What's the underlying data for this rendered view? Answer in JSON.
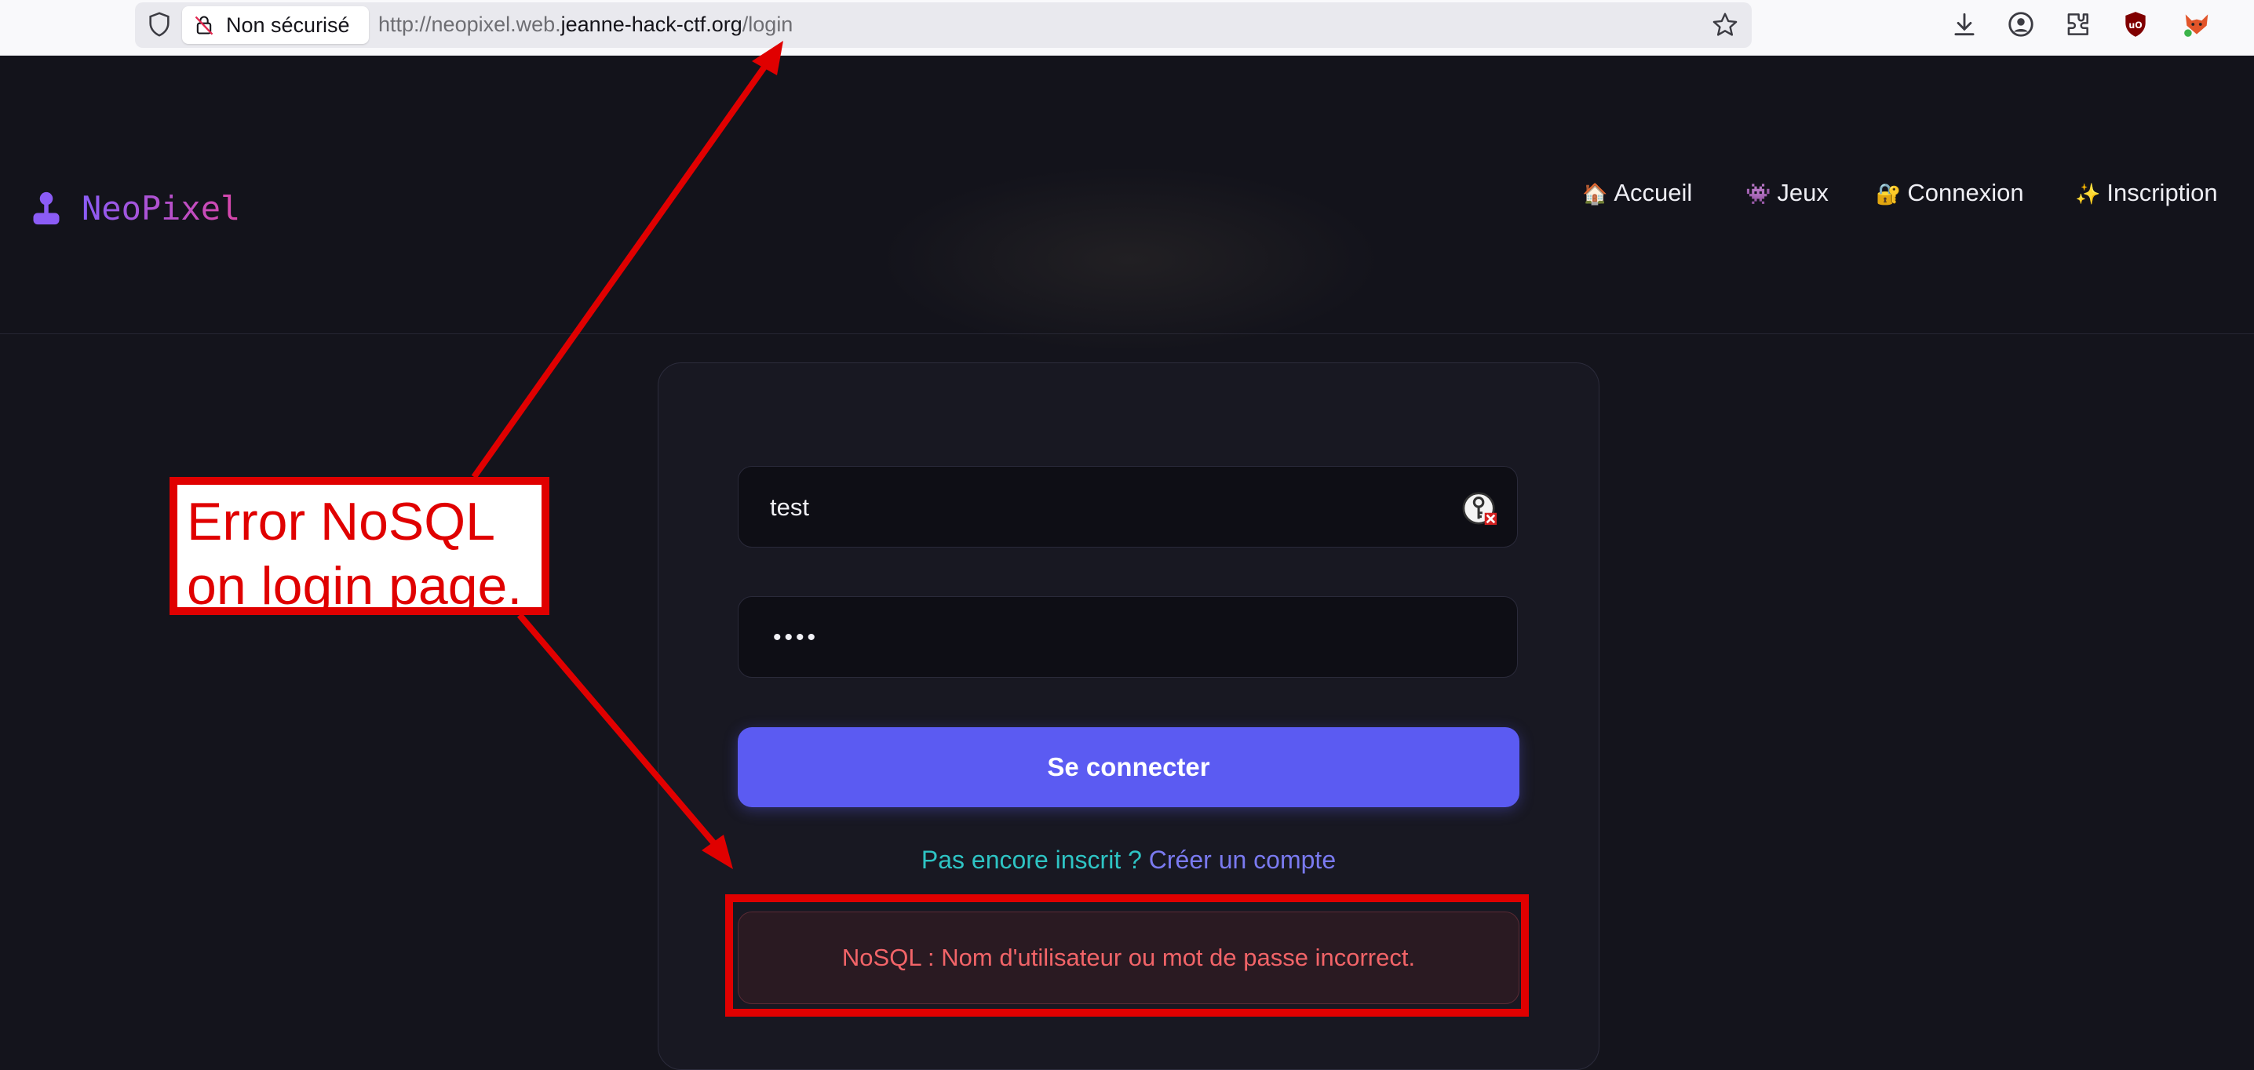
{
  "browser": {
    "security_label": "Non sécurisé",
    "url_prefix": "http://neopixel.web.",
    "url_host": "jeanne-hack-ctf.org",
    "url_path": "/login"
  },
  "site": {
    "brand": "NeoPixel",
    "nav": [
      {
        "emoji": "🏠",
        "label": "Accueil"
      },
      {
        "emoji": "👾",
        "label": "Jeux"
      },
      {
        "emoji": "🔐",
        "label": "Connexion"
      },
      {
        "emoji": "✨",
        "label": "Inscription"
      }
    ]
  },
  "login": {
    "username_value": "test",
    "password_value": "••••",
    "submit_label": "Se connecter",
    "signup_prompt": "Pas encore inscrit ?",
    "signup_link": "Créer un compte",
    "error_message": "NoSQL : Nom d'utilisateur ou mot de passe incorrect."
  },
  "annotation": {
    "line1": "Error NoSQL",
    "line2": "on login page."
  },
  "colors": {
    "accent": "#5b5bf2",
    "annotation_red": "#e00000",
    "error_text": "#f26468",
    "brand_gradient_start": "#8b5cf6",
    "brand_gradient_end": "#d946a8"
  }
}
